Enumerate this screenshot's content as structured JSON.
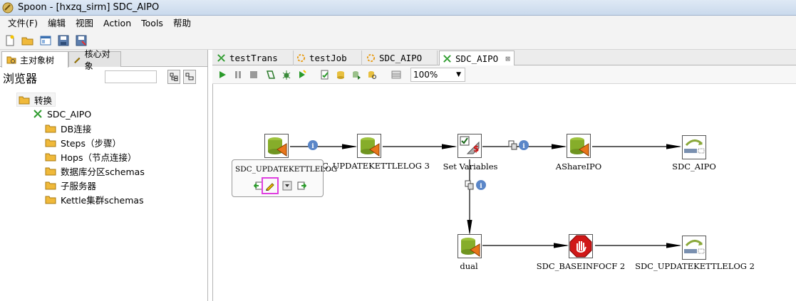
{
  "window": {
    "title": "Spoon - [hxzq_sirm] SDC_AIPO"
  },
  "menu": [
    "文件(F)",
    "编辑",
    "视图",
    "Action",
    "Tools",
    "帮助"
  ],
  "toolbar_icons": [
    "new-file-icon",
    "open-folder-icon",
    "explorer-icon",
    "save-icon",
    "save-as-icon"
  ],
  "left_panel": {
    "tabs": [
      {
        "label": "主对象树",
        "icon": "tree-icon",
        "active": true
      },
      {
        "label": "核心对象",
        "icon": "pencil-icon",
        "active": false
      }
    ],
    "browser_label": "浏览器",
    "search_placeholder": "",
    "tree": {
      "root": "转换",
      "trans": "SDC_AIPO",
      "children": [
        "DB连接",
        "Steps（步骤）",
        "Hops（节点连接）",
        "数据库分区schemas",
        "子服务器",
        "Kettle集群schemas"
      ]
    }
  },
  "editor": {
    "tabs": [
      {
        "label": "testTrans",
        "icon": "transformation-icon",
        "active": false
      },
      {
        "label": "testJob",
        "icon": "job-icon",
        "active": false
      },
      {
        "label": "SDC_AIPO",
        "icon": "job-icon",
        "active": false
      },
      {
        "label": "SDC_AIPO",
        "icon": "transformation-icon",
        "active": true,
        "close": "⊠"
      }
    ],
    "zoom": "100%",
    "toolbar_icons": [
      "run-icon",
      "pause-icon",
      "stop-icon",
      "preview-icon",
      "debug-icon",
      "replay-icon",
      "verify-icon",
      "impact-icon",
      "sql-icon",
      "explore-db-icon",
      "show-results-icon"
    ]
  },
  "canvas": {
    "steps": [
      {
        "id": "s1",
        "label": "",
        "type": "table-output"
      },
      {
        "id": "s2",
        "label": "SDC_UPDATEKETTLELOG 3",
        "type": "table-output"
      },
      {
        "id": "s3",
        "label": "Set Variables",
        "type": "set-variables"
      },
      {
        "id": "s4",
        "label": "AShareIPO",
        "type": "table-output"
      },
      {
        "id": "s5",
        "label": "SDC_AIPO",
        "type": "job-executor"
      },
      {
        "id": "s6",
        "label": "dual",
        "type": "table-output"
      },
      {
        "id": "s7",
        "label": "SDC_BASEINFOCF 2",
        "type": "abort"
      },
      {
        "id": "s8",
        "label": "SDC_UPDATEKETTLELOG 2",
        "type": "job-executor"
      }
    ],
    "hover_tip": {
      "title": "SDC_UPDATEKETTLELOG"
    }
  }
}
